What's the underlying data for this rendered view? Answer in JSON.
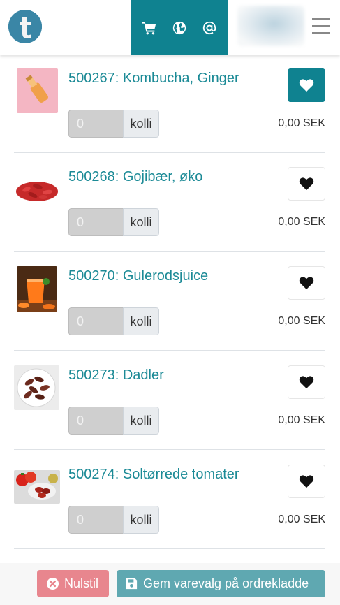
{
  "header": {
    "logo_letter": "t",
    "nav": [
      {
        "name": "cart-icon"
      },
      {
        "name": "globe-icon"
      },
      {
        "name": "at-icon"
      }
    ],
    "menu_icon": "hamburger-icon"
  },
  "products": [
    {
      "title": "500267: Kombucha, Ginger",
      "qty_value": "0",
      "unit": "kolli",
      "price": "0,00 SEK",
      "favorite": true,
      "image": "ginger-kombucha-bottle"
    },
    {
      "title": "500268: Gojibær, øko",
      "qty_value": "0",
      "unit": "kolli",
      "price": "0,00 SEK",
      "favorite": false,
      "image": "goji-berries"
    },
    {
      "title": "500270: Gulerodsjuice",
      "qty_value": "0",
      "unit": "kolli",
      "price": "0,00 SEK",
      "favorite": false,
      "image": "carrot-juice"
    },
    {
      "title": "500273: Dadler",
      "qty_value": "0",
      "unit": "kolli",
      "price": "0,00 SEK",
      "favorite": false,
      "image": "dates-plate"
    },
    {
      "title": "500274: Soltørrede tomater",
      "qty_value": "0",
      "unit": "kolli",
      "price": "0,00 SEK",
      "favorite": false,
      "image": "sun-dried-tomatoes"
    }
  ],
  "footer": {
    "reset_label": "Nulstil",
    "save_label": "Gem varevalg på ordrekladde"
  },
  "colors": {
    "primary": "#0f8290",
    "link": "#1b8a96",
    "danger": "#e8868e",
    "save": "#5fa8b1"
  }
}
